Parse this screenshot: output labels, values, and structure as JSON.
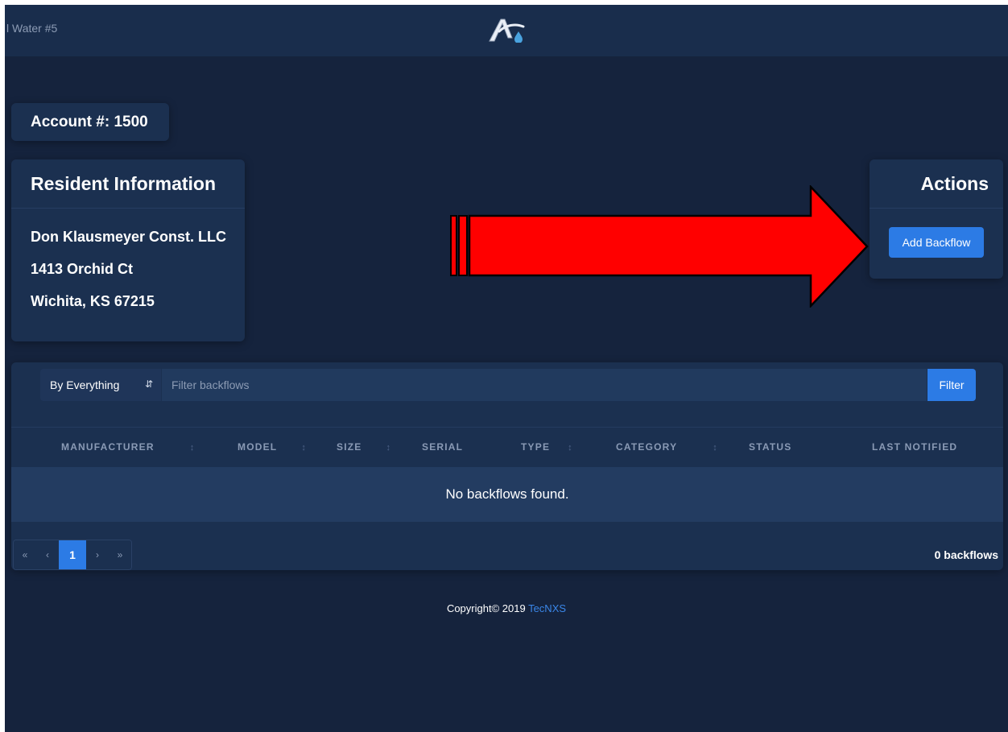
{
  "header": {
    "org_name": "l Water #5",
    "logo_icon": "aqua-drop-logo-icon"
  },
  "account": {
    "label": "Account #: 1500"
  },
  "resident": {
    "title": "Resident Information",
    "name": "Don Klausmeyer Const. LLC",
    "street": "1413 Orchid Ct",
    "city_line": "Wichita, KS 67215"
  },
  "actions": {
    "title": "Actions",
    "add_backflow_label": "Add Backflow"
  },
  "annotation": {
    "arrow_icon": "red-arrow-icon",
    "arrow_color": "#ff0000"
  },
  "filter": {
    "select_value": "By Everything",
    "placeholder": "Filter backflows",
    "button_label": "Filter"
  },
  "table": {
    "columns": [
      "MANUFACTURER",
      "MODEL",
      "SIZE",
      "SERIAL",
      "TYPE",
      "CATEGORY",
      "STATUS",
      "LAST NOTIFIED"
    ],
    "empty_message": "No backflows found."
  },
  "pagination": {
    "first": "«",
    "prev": "‹",
    "current": "1",
    "next": "›",
    "last": "»",
    "count_label": "0 backflows"
  },
  "footer": {
    "copyright": "Copyright© 2019",
    "company": "TecNXS"
  },
  "colors": {
    "background": "#15233d",
    "card": "#1b3050",
    "accent": "#2c7be5"
  }
}
